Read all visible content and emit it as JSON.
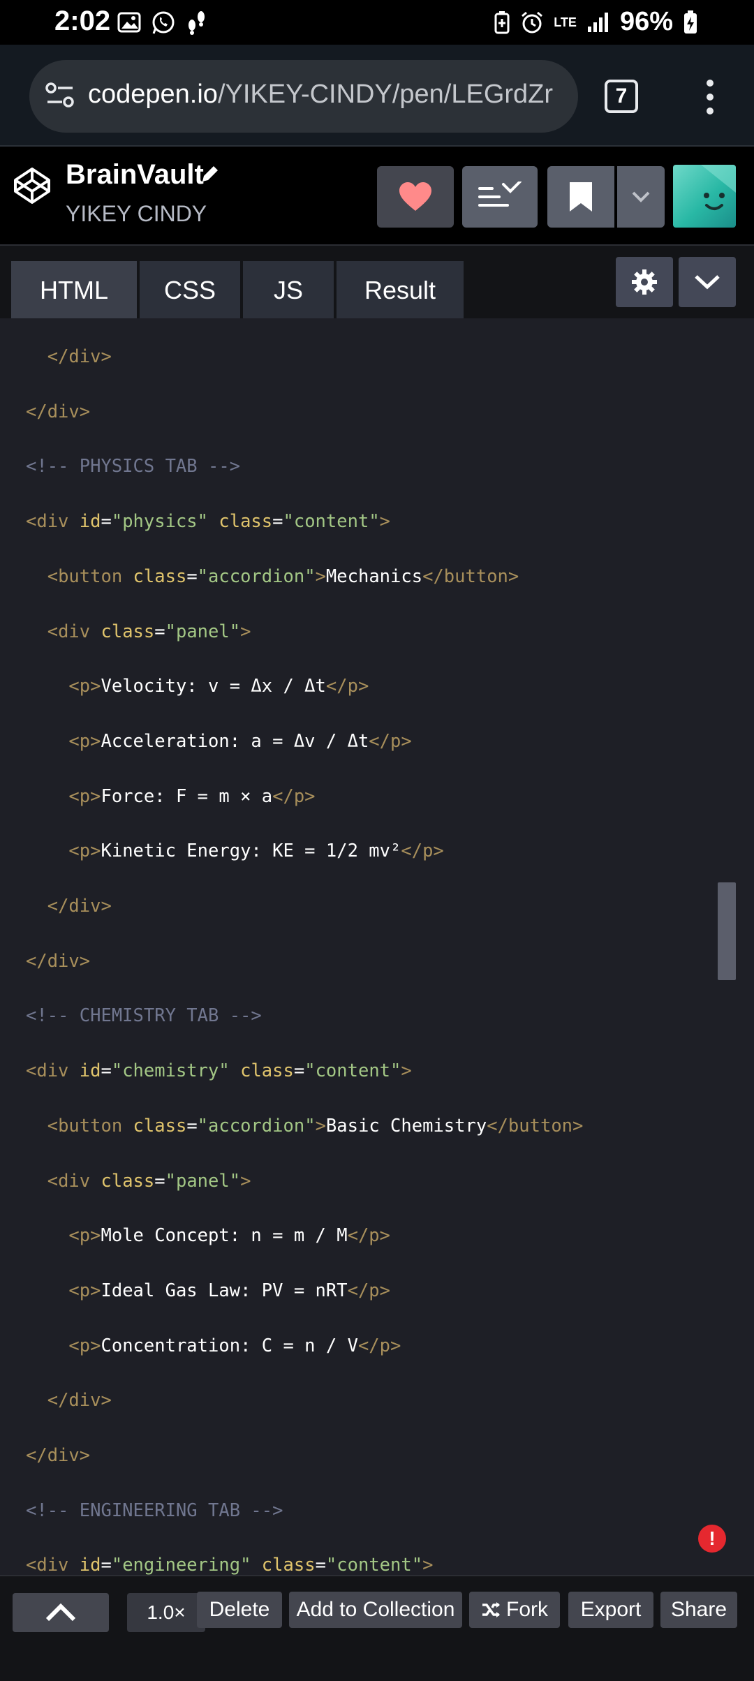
{
  "status_bar": {
    "time": "2:02",
    "battery": "96%",
    "network": "LTE",
    "icons_left": [
      "gallery-icon",
      "whatsapp-icon",
      "footsteps-icon"
    ],
    "icons_right": [
      "battery-saver-icon",
      "alarm-icon",
      "lte-icon",
      "signal-icon",
      "battery-charging-icon"
    ]
  },
  "browser": {
    "url_host": "codepen.io",
    "url_path": "/YIKEY-CINDY/pen/LEGrdZr",
    "tab_count": "7"
  },
  "pen": {
    "title": "BrainVault",
    "author": "YIKEY CINDY"
  },
  "editor_tabs": [
    {
      "label": "HTML",
      "active": true
    },
    {
      "label": "CSS",
      "active": false
    },
    {
      "label": "JS",
      "active": false
    },
    {
      "label": "Result",
      "active": false
    }
  ],
  "code_lines": [
    [
      {
        "t": "  ",
        "c": "tx"
      },
      {
        "t": "</div>",
        "c": "tg"
      }
    ],
    [
      {
        "t": "</div>",
        "c": "tg"
      }
    ],
    [
      {
        "t": "<!-- PHYSICS TAB -->",
        "c": "cm"
      }
    ],
    [
      {
        "t": "<div ",
        "c": "tg"
      },
      {
        "t": "id",
        "c": "at"
      },
      {
        "t": "=",
        "c": "tx"
      },
      {
        "t": "\"physics\"",
        "c": "st"
      },
      {
        "t": " ",
        "c": "tx"
      },
      {
        "t": "class",
        "c": "at"
      },
      {
        "t": "=",
        "c": "tx"
      },
      {
        "t": "\"content\"",
        "c": "st"
      },
      {
        "t": ">",
        "c": "tg"
      }
    ],
    [
      {
        "t": "  ",
        "c": "tx"
      },
      {
        "t": "<button ",
        "c": "tg"
      },
      {
        "t": "class",
        "c": "at"
      },
      {
        "t": "=",
        "c": "tx"
      },
      {
        "t": "\"accordion\"",
        "c": "st"
      },
      {
        "t": ">",
        "c": "tg"
      },
      {
        "t": "Mechanics",
        "c": "tx"
      },
      {
        "t": "</button>",
        "c": "tg"
      }
    ],
    [
      {
        "t": "  ",
        "c": "tx"
      },
      {
        "t": "<div ",
        "c": "tg"
      },
      {
        "t": "class",
        "c": "at"
      },
      {
        "t": "=",
        "c": "tx"
      },
      {
        "t": "\"panel\"",
        "c": "st"
      },
      {
        "t": ">",
        "c": "tg"
      }
    ],
    [
      {
        "t": "    ",
        "c": "tx"
      },
      {
        "t": "<p>",
        "c": "tg"
      },
      {
        "t": "Velocity: v = Δx / Δt",
        "c": "tx"
      },
      {
        "t": "</p>",
        "c": "tg"
      }
    ],
    [
      {
        "t": "    ",
        "c": "tx"
      },
      {
        "t": "<p>",
        "c": "tg"
      },
      {
        "t": "Acceleration: a = Δv / Δt",
        "c": "tx"
      },
      {
        "t": "</p>",
        "c": "tg"
      }
    ],
    [
      {
        "t": "    ",
        "c": "tx"
      },
      {
        "t": "<p>",
        "c": "tg"
      },
      {
        "t": "Force: F = m × a",
        "c": "tx"
      },
      {
        "t": "</p>",
        "c": "tg"
      }
    ],
    [
      {
        "t": "    ",
        "c": "tx"
      },
      {
        "t": "<p>",
        "c": "tg"
      },
      {
        "t": "Kinetic Energy: KE = 1/2 mv²",
        "c": "tx"
      },
      {
        "t": "</p>",
        "c": "tg"
      }
    ],
    [
      {
        "t": "  ",
        "c": "tx"
      },
      {
        "t": "</div>",
        "c": "tg"
      }
    ],
    [
      {
        "t": "</div>",
        "c": "tg"
      }
    ],
    [
      {
        "t": "<!-- CHEMISTRY TAB -->",
        "c": "cm"
      }
    ],
    [
      {
        "t": "<div ",
        "c": "tg"
      },
      {
        "t": "id",
        "c": "at"
      },
      {
        "t": "=",
        "c": "tx"
      },
      {
        "t": "\"chemistry\"",
        "c": "st"
      },
      {
        "t": " ",
        "c": "tx"
      },
      {
        "t": "class",
        "c": "at"
      },
      {
        "t": "=",
        "c": "tx"
      },
      {
        "t": "\"content\"",
        "c": "st"
      },
      {
        "t": ">",
        "c": "tg"
      }
    ],
    [
      {
        "t": "  ",
        "c": "tx"
      },
      {
        "t": "<button ",
        "c": "tg"
      },
      {
        "t": "class",
        "c": "at"
      },
      {
        "t": "=",
        "c": "tx"
      },
      {
        "t": "\"accordion\"",
        "c": "st"
      },
      {
        "t": ">",
        "c": "tg"
      },
      {
        "t": "Basic Chemistry",
        "c": "tx"
      },
      {
        "t": "</button>",
        "c": "tg"
      }
    ],
    [
      {
        "t": "  ",
        "c": "tx"
      },
      {
        "t": "<div ",
        "c": "tg"
      },
      {
        "t": "class",
        "c": "at"
      },
      {
        "t": "=",
        "c": "tx"
      },
      {
        "t": "\"panel\"",
        "c": "st"
      },
      {
        "t": ">",
        "c": "tg"
      }
    ],
    [
      {
        "t": "    ",
        "c": "tx"
      },
      {
        "t": "<p>",
        "c": "tg"
      },
      {
        "t": "Mole Concept: n = m / M",
        "c": "tx"
      },
      {
        "t": "</p>",
        "c": "tg"
      }
    ],
    [
      {
        "t": "    ",
        "c": "tx"
      },
      {
        "t": "<p>",
        "c": "tg"
      },
      {
        "t": "Ideal Gas Law: PV = nRT",
        "c": "tx"
      },
      {
        "t": "</p>",
        "c": "tg"
      }
    ],
    [
      {
        "t": "    ",
        "c": "tx"
      },
      {
        "t": "<p>",
        "c": "tg"
      },
      {
        "t": "Concentration: C = n / V",
        "c": "tx"
      },
      {
        "t": "</p>",
        "c": "tg"
      }
    ],
    [
      {
        "t": "  ",
        "c": "tx"
      },
      {
        "t": "</div>",
        "c": "tg"
      }
    ],
    [
      {
        "t": "</div>",
        "c": "tg"
      }
    ],
    [
      {
        "t": "<!-- ENGINEERING TAB -->",
        "c": "cm"
      }
    ],
    [
      {
        "t": "<div ",
        "c": "tg"
      },
      {
        "t": "id",
        "c": "at"
      },
      {
        "t": "=",
        "c": "tx"
      },
      {
        "t": "\"engineering\"",
        "c": "st"
      },
      {
        "t": " ",
        "c": "tx"
      },
      {
        "t": "class",
        "c": "at"
      },
      {
        "t": "=",
        "c": "tx"
      },
      {
        "t": "\"content\"",
        "c": "st"
      },
      {
        "t": ">",
        "c": "tg"
      }
    ]
  ],
  "error_badge": "!",
  "bottom_bar": {
    "zoom": "1.0×",
    "delete": "Delete",
    "add_to_collection": "Add to Collection",
    "fork": "Fork",
    "export": "Export",
    "share": "Share"
  },
  "colors": {
    "editor_bg": "#1e1f26",
    "tag": "#a88f5b",
    "attribute": "#e0c46c",
    "string": "#a3c785",
    "text": "#ffffff",
    "comment": "#717790",
    "heart": "#ff8a8a",
    "error": "#e5282f"
  }
}
